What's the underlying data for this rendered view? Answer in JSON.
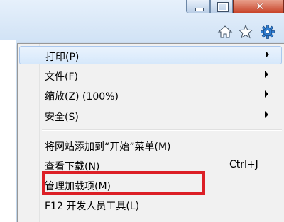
{
  "window": {
    "caption_buttons": [
      "minimize",
      "maximize",
      "close"
    ]
  },
  "toolbar": {
    "icons": [
      "home-icon",
      "favorites-star-icon",
      "tools-gear-icon"
    ]
  },
  "menu": {
    "items": [
      {
        "label": "打印(P)",
        "submenu": true
      },
      {
        "label": "文件(F)",
        "submenu": true
      },
      {
        "label": "缩放(Z) (100%)",
        "submenu": true
      },
      {
        "label": "安全(S)",
        "submenu": true
      },
      {
        "label": "将网站添加到“开始”菜单(M)",
        "submenu": false
      },
      {
        "label": "查看下载(N)",
        "shortcut": "Ctrl+J",
        "submenu": false
      },
      {
        "label": "管理加载项(M)",
        "submenu": false,
        "highlighted": true
      },
      {
        "label": "F12 开发人员工具(L)",
        "submenu": false
      }
    ]
  },
  "colors": {
    "frame": "#c6dcf2",
    "menu_bg": "#f1f1f1",
    "highlight": "#d6e8fb",
    "callout": "#dc1f26",
    "close_button": "#c8442a"
  }
}
